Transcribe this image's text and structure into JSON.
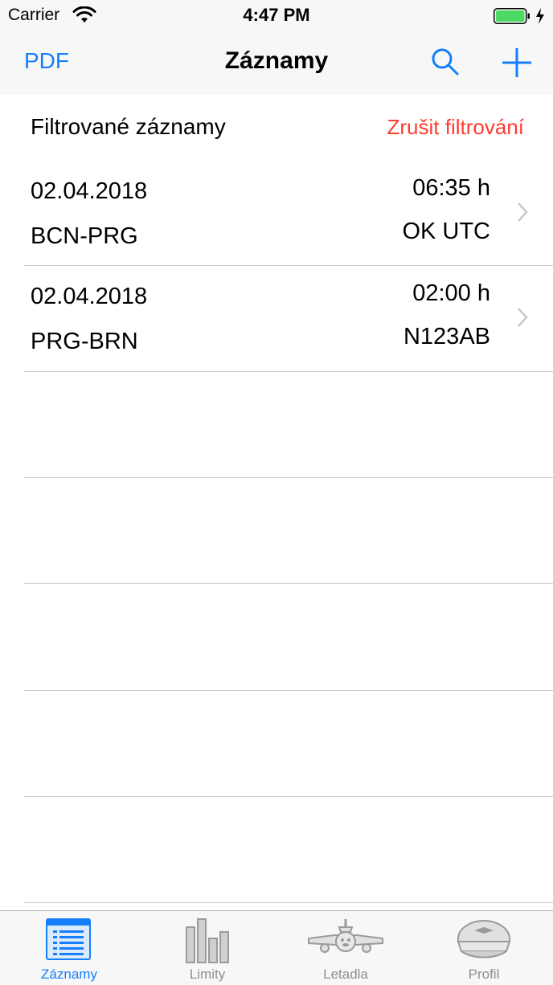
{
  "status_bar": {
    "carrier": "Carrier",
    "time": "4:47 PM"
  },
  "nav": {
    "left_button": "PDF",
    "title": "Záznamy",
    "icons": [
      "search-icon",
      "plus-icon"
    ]
  },
  "filter_header": {
    "title": "Filtrované záznamy",
    "cancel": "Zrušit filtrování"
  },
  "records": [
    {
      "date": "02.04.2018",
      "route": "BCN-PRG",
      "duration": "06:35 h",
      "registration": "OK UTC"
    },
    {
      "date": "02.04.2018",
      "route": "PRG-BRN",
      "duration": "02:00 h",
      "registration": "N123AB"
    }
  ],
  "tab_bar": {
    "items": [
      {
        "label": "Záznamy",
        "icon": "logbook-icon",
        "active": true
      },
      {
        "label": "Limity",
        "icon": "bar-chart-icon",
        "active": false
      },
      {
        "label": "Letadla",
        "icon": "airplane-icon",
        "active": false
      },
      {
        "label": "Profil",
        "icon": "pilot-cap-icon",
        "active": false
      }
    ]
  },
  "colors": {
    "accent": "#157efb",
    "destructive": "#ff3b30",
    "battery": "#4cd964",
    "separator": "#c8c7cc",
    "inactive_tab": "#8e8e8e"
  }
}
